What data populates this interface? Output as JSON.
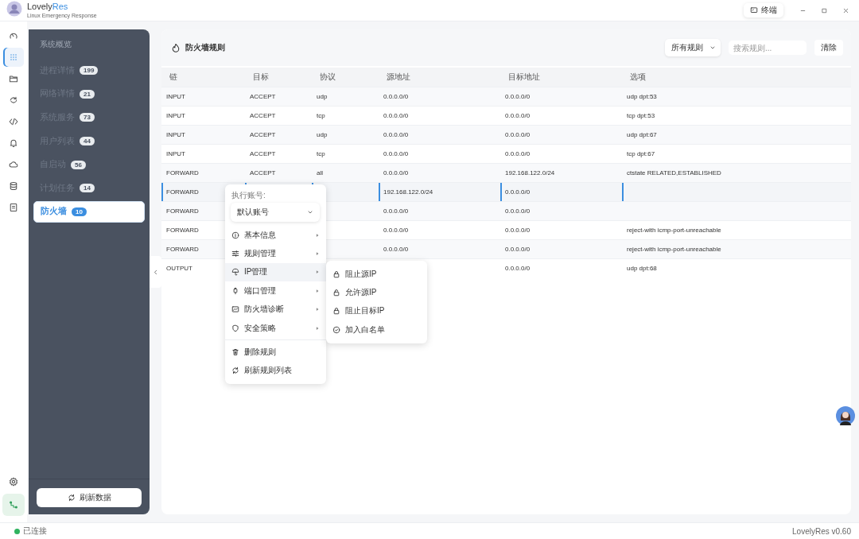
{
  "window": {
    "brand_main": "Lovely",
    "brand_accent": "Res",
    "subtitle": "Linux Emergency Response",
    "terminal_button": "终端"
  },
  "rail": [
    {
      "selected": false
    },
    {
      "selected": true
    },
    {
      "selected": false
    },
    {
      "selected": false
    },
    {
      "selected": false
    },
    {
      "selected": false
    },
    {
      "selected": false
    },
    {
      "selected": false
    },
    {
      "selected": false
    }
  ],
  "sidebar": {
    "heading": "系统概览",
    "items": [
      {
        "label": "进程详情",
        "count": "199",
        "selected": false
      },
      {
        "label": "网络详情",
        "count": "21",
        "selected": false
      },
      {
        "label": "系统服务",
        "count": "73",
        "selected": false
      },
      {
        "label": "用户列表",
        "count": "44",
        "selected": false
      },
      {
        "label": "自启动",
        "count": "56",
        "selected": false
      },
      {
        "label": "计划任务",
        "count": "14",
        "selected": false
      },
      {
        "label": "防火墙",
        "count": "10",
        "selected": true
      }
    ],
    "refresh_button": "刷新数据"
  },
  "panel": {
    "title": "防火墙规则",
    "filter": "所有规则",
    "search": {
      "placeholder": "搜索规则..."
    },
    "clear_button": "清除"
  },
  "table": {
    "columns": [
      "链",
      "目标",
      "协议",
      "源地址",
      "目标地址",
      "选项"
    ],
    "rows": [
      {
        "cells": [
          "INPUT",
          "ACCEPT",
          "udp",
          "0.0.0.0/0",
          "0.0.0.0/0",
          "udp dpt:53"
        ],
        "selected": false
      },
      {
        "cells": [
          "INPUT",
          "ACCEPT",
          "tcp",
          "0.0.0.0/0",
          "0.0.0.0/0",
          "tcp dpt:53"
        ],
        "selected": false
      },
      {
        "cells": [
          "INPUT",
          "ACCEPT",
          "udp",
          "0.0.0.0/0",
          "0.0.0.0/0",
          "udp dpt:67"
        ],
        "selected": false
      },
      {
        "cells": [
          "INPUT",
          "ACCEPT",
          "tcp",
          "0.0.0.0/0",
          "0.0.0.0/0",
          "tcp dpt:67"
        ],
        "selected": false
      },
      {
        "cells": [
          "FORWARD",
          "ACCEPT",
          "all",
          "0.0.0.0/0",
          "192.168.122.0/24",
          "ctstate RELATED,ESTABLISHED"
        ],
        "selected": false
      },
      {
        "cells": [
          "FORWARD",
          null,
          null,
          "192.168.122.0/24",
          "0.0.0.0/0",
          null
        ],
        "selected": true
      },
      {
        "cells": [
          "FORWARD",
          null,
          null,
          "0.0.0.0/0",
          "0.0.0.0/0",
          null
        ],
        "selected": false
      },
      {
        "cells": [
          "FORWARD",
          null,
          null,
          "0.0.0.0/0",
          "0.0.0.0/0",
          "reject-with icmp-port-unreachable"
        ],
        "selected": false
      },
      {
        "cells": [
          "FORWARD",
          null,
          null,
          "0.0.0.0/0",
          "0.0.0.0/0",
          "reject-with icmp-port-unreachable"
        ],
        "selected": false
      },
      {
        "cells": [
          "OUTPUT",
          null,
          null,
          null,
          "0.0.0.0/0",
          "udp dpt:68"
        ],
        "selected": false
      }
    ]
  },
  "context_menu": {
    "account_label": "执行账号:",
    "account": "默认账号",
    "submenus": [
      {
        "label": "基本信息",
        "selected": false
      },
      {
        "label": "规则管理",
        "selected": false
      },
      {
        "label": "IP管理",
        "selected": true
      },
      {
        "label": "端口管理",
        "selected": false
      },
      {
        "label": "防火墙诊断",
        "selected": false
      },
      {
        "label": "安全策略",
        "selected": false
      }
    ],
    "actions": [
      {
        "label": "删除规则"
      },
      {
        "label": "刷新规则列表"
      }
    ]
  },
  "submenu": {
    "items": [
      {
        "label": "阻止源IP"
      },
      {
        "label": "允许源IP"
      },
      {
        "label": "阻止目标IP"
      },
      {
        "label": "加入白名单"
      }
    ]
  },
  "status_bar": {
    "connection": "已连接",
    "version": "LovelyRes v0.60"
  }
}
